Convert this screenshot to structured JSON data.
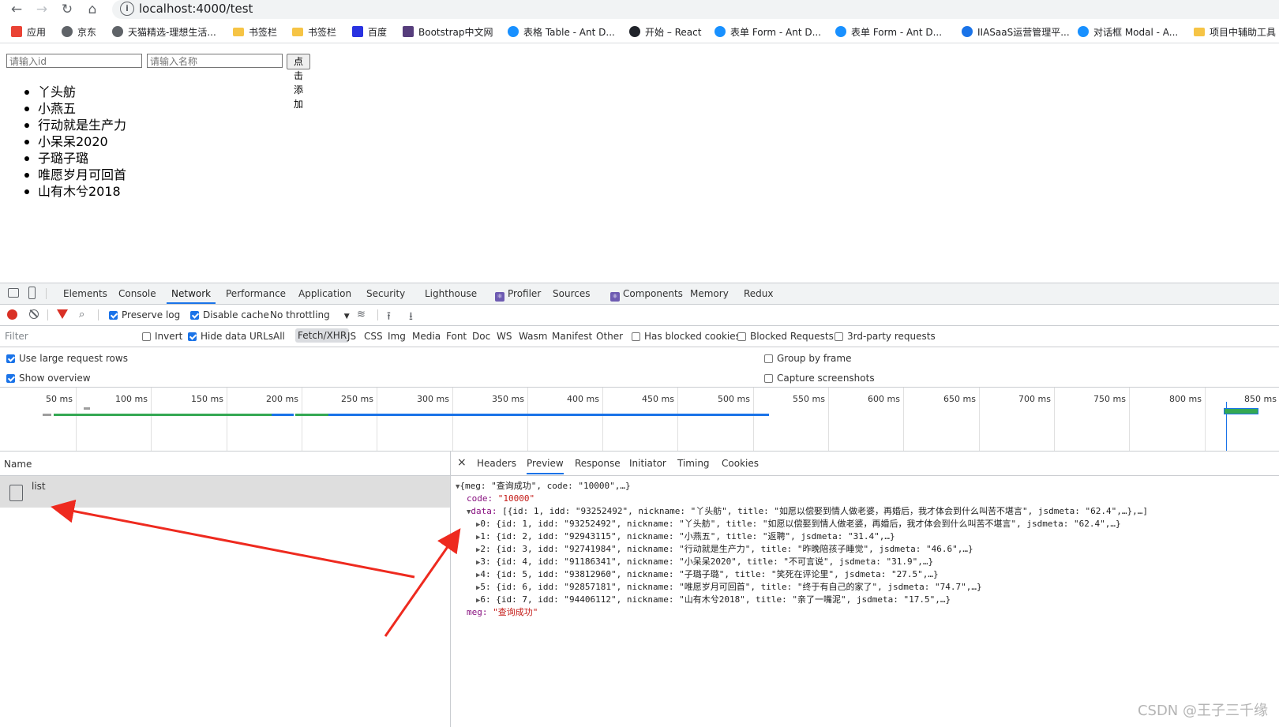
{
  "browser": {
    "url": "localhost:4000/test",
    "bookmarks": [
      {
        "label": "应用",
        "icon": "apps-grid-icon",
        "color": "#ea4335"
      },
      {
        "label": "京东",
        "icon": "globe-icon",
        "color": "#5f6368"
      },
      {
        "label": "天猫精选-理想生活...",
        "icon": "globe-icon",
        "color": "#5f6368"
      },
      {
        "label": "书签栏",
        "icon": "folder-icon",
        "color": "#f6c445"
      },
      {
        "label": "书签栏",
        "icon": "folder-icon",
        "color": "#f6c445"
      },
      {
        "label": "百度",
        "icon": "baidu-paw-icon",
        "color": "#2932e1"
      },
      {
        "label": "Bootstrap中文网",
        "icon": "bootstrap-icon",
        "color": "#563d7c"
      },
      {
        "label": "表格 Table - Ant D...",
        "icon": "antd-icon",
        "color": "#1890ff"
      },
      {
        "label": "开始 – React",
        "icon": "react-icon",
        "color": "#20232a"
      },
      {
        "label": "表单 Form - Ant D...",
        "icon": "antd-icon",
        "color": "#1890ff"
      },
      {
        "label": "表单 Form - Ant D...",
        "icon": "antd-icon",
        "color": "#1890ff"
      },
      {
        "label": "IIASaaS运营管理平...",
        "icon": "cloud-icon",
        "color": "#1a73e8"
      },
      {
        "label": "对话框 Modal - A...",
        "icon": "antd-icon",
        "color": "#1890ff"
      },
      {
        "label": "项目中辅助工具",
        "icon": "folder-icon",
        "color": "#f6c445"
      }
    ]
  },
  "page": {
    "id_placeholder": "请输入id",
    "name_placeholder": "请输入名称",
    "add_button": "点击添加",
    "items": [
      "丫头舫",
      "小燕五",
      "行动就是生产力",
      "小呆呆2020",
      "子璐子璐",
      "唯愿岁月可回首",
      "山有木兮2018"
    ]
  },
  "devtools": {
    "tabs": [
      "Elements",
      "Console",
      "Network",
      "Performance",
      "Application",
      "Security",
      "Lighthouse",
      "Profiler",
      "Sources",
      "Components",
      "Memory",
      "Redux"
    ],
    "active_tab": "Network",
    "toolbar": {
      "preserve_log": "Preserve log",
      "disable_cache": "Disable cache",
      "throttling": "No throttling"
    },
    "filter": {
      "placeholder": "Filter",
      "invert": "Invert",
      "hide_data_urls": "Hide data URLs",
      "types": [
        "All",
        "Fetch/XHR",
        "JS",
        "CSS",
        "Img",
        "Media",
        "Font",
        "Doc",
        "WS",
        "Wasm",
        "Manifest",
        "Other"
      ],
      "active_type": "Fetch/XHR",
      "has_blocked_cookies": "Has blocked cookies",
      "blocked_requests": "Blocked Requests",
      "third_party": "3rd-party requests"
    },
    "options": {
      "large_rows": "Use large request rows",
      "show_overview": "Show overview",
      "group_by_frame": "Group by frame",
      "capture_screenshots": "Capture screenshots"
    },
    "timeline_ticks": [
      "50 ms",
      "100 ms",
      "150 ms",
      "200 ms",
      "250 ms",
      "300 ms",
      "350 ms",
      "400 ms",
      "450 ms",
      "500 ms",
      "550 ms",
      "600 ms",
      "650 ms",
      "700 ms",
      "750 ms",
      "800 ms",
      "850 ms"
    ],
    "name_header": "Name",
    "request_name": "list",
    "close_glyph": "×",
    "preview_tabs": [
      "Headers",
      "Preview",
      "Response",
      "Initiator",
      "Timing",
      "Cookies"
    ],
    "active_preview_tab": "Preview",
    "json_lines": [
      {
        "tri": "▼",
        "key": "",
        "text": "{meg: \"查询成功\", code: \"10000\",…}"
      },
      {
        "tri": "",
        "key": "code",
        "text": "\"10000\""
      },
      {
        "tri": "▼",
        "key": "data",
        "text": "[{id: 1, idd: \"93252492\", nickname: \"丫头舫\", title: \"如愿以偿娶到情人做老婆，再婚后，我才体会到什么叫苦不堪言\", jsdmeta: \"62.4\",…},…]"
      },
      {
        "tri": "▶",
        "key": "",
        "text": "0: {id: 1, idd: \"93252492\", nickname: \"丫头舫\", title: \"如愿以偿娶到情人做老婆，再婚后，我才体会到什么叫苦不堪言\", jsdmeta: \"62.4\",…}"
      },
      {
        "tri": "▶",
        "key": "",
        "text": "1: {id: 2, idd: \"92943115\", nickname: \"小燕五\", title: \"返聘\", jsdmeta: \"31.4\",…}"
      },
      {
        "tri": "▶",
        "key": "",
        "text": "2: {id: 3, idd: \"92741984\", nickname: \"行动就是生产力\", title: \"昨晚陪孩子睡觉\", jsdmeta: \"46.6\",…}"
      },
      {
        "tri": "▶",
        "key": "",
        "text": "3: {id: 4, idd: \"91186341\", nickname: \"小呆呆2020\", title: \"不可言说\", jsdmeta: \"31.9\",…}"
      },
      {
        "tri": "▶",
        "key": "",
        "text": "4: {id: 5, idd: \"93812960\", nickname: \"子璐子璐\", title: \"笑死在评论里\", jsdmeta: \"27.5\",…}"
      },
      {
        "tri": "▶",
        "key": "",
        "text": "5: {id: 6, idd: \"92857181\", nickname: \"唯愿岁月可回首\", title: \"终于有自己的家了\", jsdmeta: \"74.7\",…}"
      },
      {
        "tri": "▶",
        "key": "",
        "text": "6: {id: 7, idd: \"94406112\", nickname: \"山有木兮2018\", title: \"亲了一嘴泥\", jsdmeta: \"17.5\",…}"
      },
      {
        "tri": "",
        "key": "meg",
        "text": "\"查询成功\""
      }
    ]
  },
  "watermark": "CSDN @王子三千缘"
}
